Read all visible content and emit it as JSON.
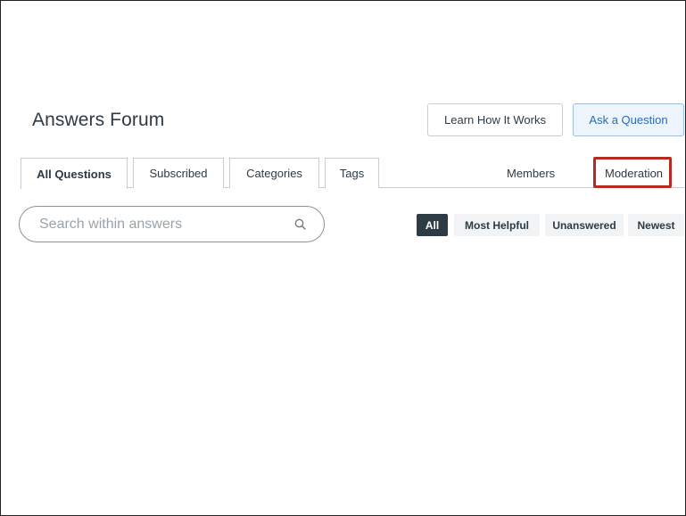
{
  "header": {
    "title": "Answers Forum",
    "learn_button": "Learn How It Works",
    "ask_button": "Ask a Question"
  },
  "tabs": [
    {
      "label": "All Questions",
      "active": true
    },
    {
      "label": "Subscribed",
      "active": false
    },
    {
      "label": "Categories",
      "active": false
    },
    {
      "label": "Tags",
      "active": false
    }
  ],
  "right_links": {
    "members": "Members",
    "moderation": "Moderation"
  },
  "search": {
    "placeholder": "Search within answers",
    "value": ""
  },
  "filters": [
    {
      "label": "All",
      "selected": true
    },
    {
      "label": "Most Helpful",
      "selected": false
    },
    {
      "label": "Unanswered",
      "selected": false
    },
    {
      "label": "Newest",
      "selected": false
    }
  ],
  "colors": {
    "highlight": "#b52b20",
    "accent": "#2a6ab4",
    "text": "#2d3b45"
  }
}
